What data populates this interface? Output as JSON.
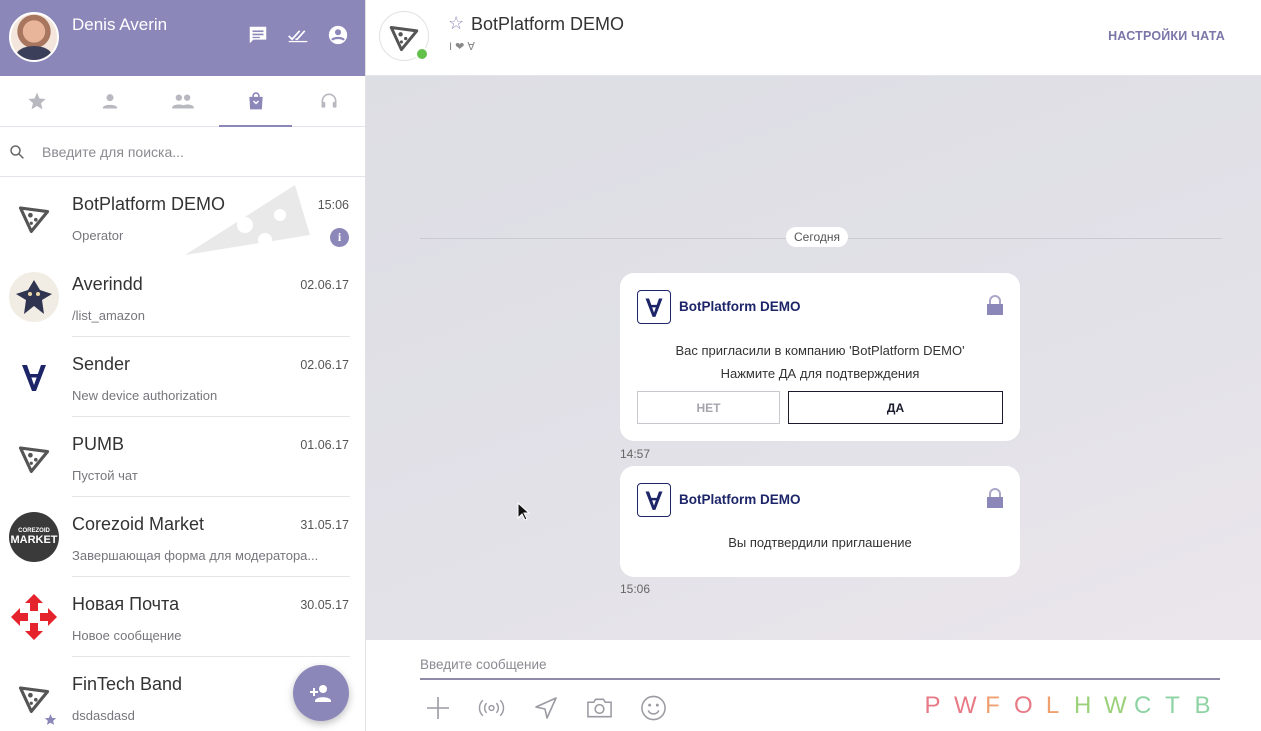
{
  "profile": {
    "name": "Denis Averin"
  },
  "search": {
    "placeholder": "Введите для поиска..."
  },
  "chats": [
    {
      "title": "BotPlatform DEMO",
      "subtitle": "Operator",
      "date": "15:06"
    },
    {
      "title": "Averindd",
      "subtitle": "/list_amazon",
      "date": "02.06.17"
    },
    {
      "title": "Sender",
      "subtitle": "New device authorization",
      "date": "02.06.17"
    },
    {
      "title": "PUMB",
      "subtitle": "Пустой чат",
      "date": "01.06.17"
    },
    {
      "title": "Corezoid Market",
      "subtitle": "Завершающая форма для модератора...",
      "date": "31.05.17",
      "avatar_text": [
        "COREZOID",
        "MARKET"
      ]
    },
    {
      "title": "Новая Почта",
      "subtitle": "Новое сообщение",
      "date": "30.05.17"
    },
    {
      "title": "FinTech Band",
      "subtitle": "dsdasdasd",
      "date": ""
    }
  ],
  "header": {
    "title": "BotPlatform DEMO",
    "subtitle": "I ❤ ∀",
    "settings_label": "НАСТРОЙКИ ЧАТА"
  },
  "messages": {
    "date_label": "Сегодня",
    "card1": {
      "brand": "BotPlatform DEMO",
      "line1": "Вас пригласили в компанию 'BotPlatform DEMO'",
      "line2": "Нажмите ДА для подтверждения",
      "no_label": "НЕТ",
      "yes_label": "ДА",
      "time": "14:57"
    },
    "card2": {
      "brand": "BotPlatform DEMO",
      "line1": "Вы подтвердили приглашение",
      "time": "15:06"
    }
  },
  "composer": {
    "placeholder": "Введите сообщение",
    "letters": [
      {
        "char": "P",
        "color": "#e87a86"
      },
      {
        "char": "W",
        "color": "#e87a86"
      },
      {
        "char": "F",
        "color": "#f0a070"
      },
      {
        "char": "O",
        "color": "#e87a86"
      },
      {
        "char": "L",
        "color": "#f0a070"
      },
      {
        "char": "H",
        "color": "#9ad17a"
      },
      {
        "char": "W",
        "color": "#9ad17a"
      },
      {
        "char": "C",
        "color": "#8ed3a3"
      },
      {
        "char": "T",
        "color": "#8ed3a3"
      },
      {
        "char": "B",
        "color": "#8ed3a3"
      }
    ]
  },
  "colors": {
    "accent": "#8c87b9",
    "online": "#62c04b",
    "brand_navy": "#1d2569"
  }
}
